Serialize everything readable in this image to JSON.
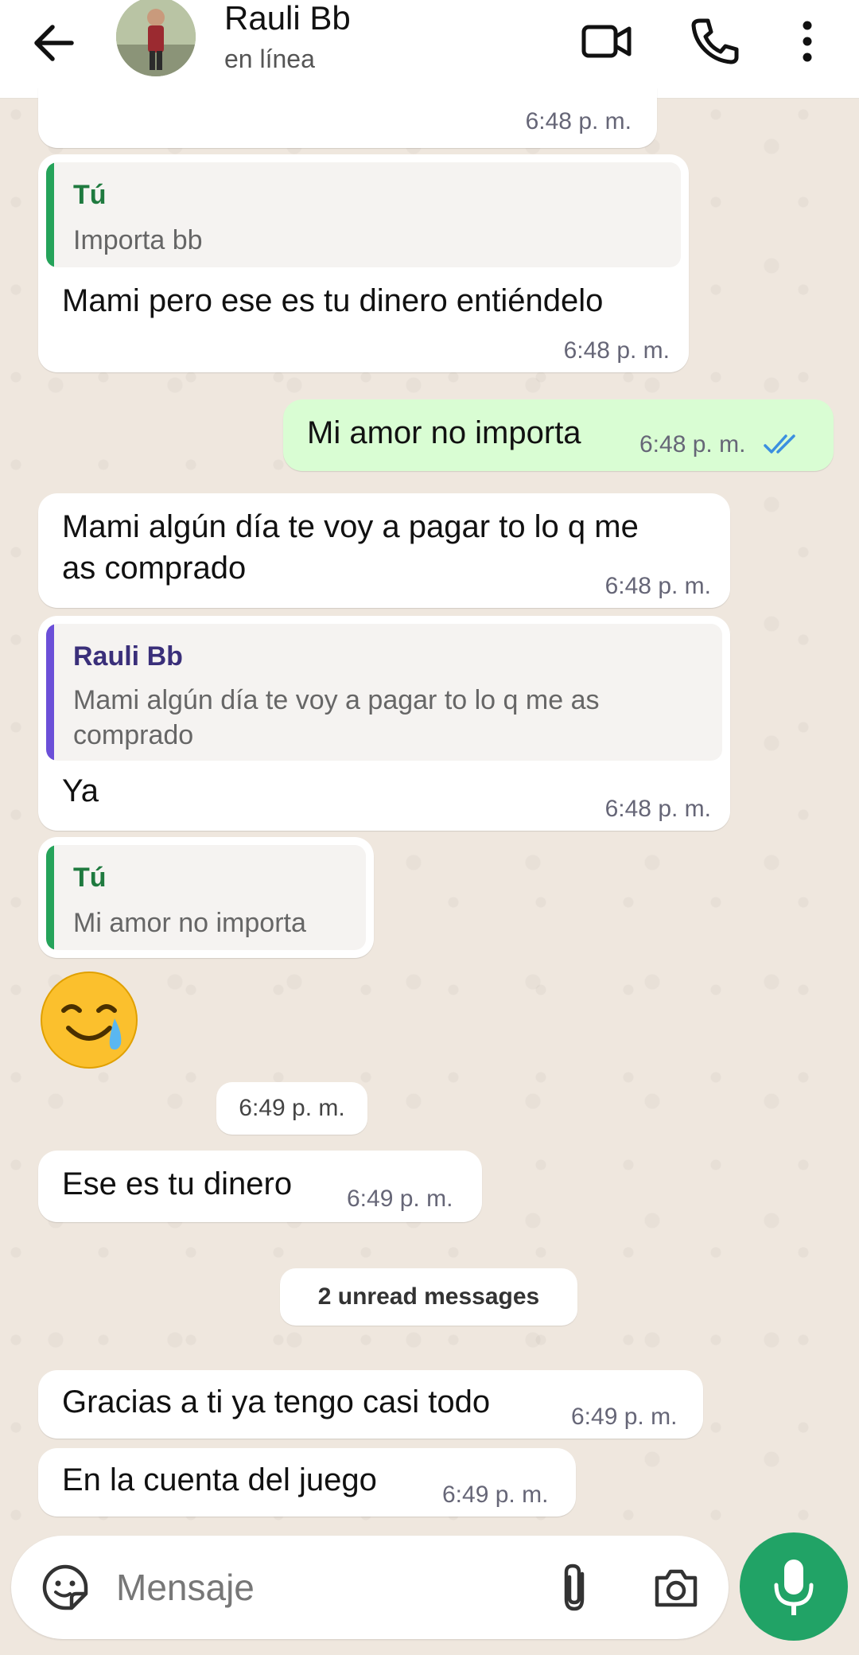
{
  "header": {
    "contact_name": "Rauli Bb",
    "status": "en línea",
    "icons": [
      "arrow-back-icon",
      "video-call-icon",
      "phone-icon",
      "more-vertical-icon"
    ]
  },
  "messages": [
    {
      "direction": "in",
      "text": "",
      "time": "6:48 p. m."
    },
    {
      "direction": "in",
      "quote": {
        "author": "Tú",
        "text": "Importa bb"
      },
      "text": "Mami pero ese es tu dinero entiéndelo",
      "time": "6:48 p. m."
    },
    {
      "direction": "out",
      "text": "Mi amor no importa",
      "time": "6:48 p. m.",
      "status": "read"
    },
    {
      "direction": "in",
      "text_line1": "Mami algún día te voy a pagar to lo q me",
      "text_line2": "as comprado",
      "time": "6:48 p. m."
    },
    {
      "direction": "in",
      "quote": {
        "author": "Rauli Bb",
        "text_line1": "Mami algún día te voy a pagar to lo q me as",
        "text_line2": "comprado"
      },
      "text": "Ya",
      "time": "6:48 p. m."
    },
    {
      "direction": "in",
      "quote": {
        "author": "Tú",
        "text": "Mi amor no importa"
      },
      "emoji": "🥲",
      "time": "6:49 p. m."
    },
    {
      "direction": "in",
      "text": "Ese es tu dinero",
      "time": "6:49 p. m."
    },
    {
      "direction": "in",
      "text": "Gracias a ti ya tengo casi todo",
      "time": "6:49 p. m."
    },
    {
      "direction": "in",
      "text": "En la cuenta del juego",
      "time": "6:49 p. m."
    }
  ],
  "unread_divider": "2 unread messages",
  "composer": {
    "placeholder": "Mensaje",
    "icons": [
      "sticker-icon",
      "attach-icon",
      "camera-icon",
      "mic-icon"
    ]
  },
  "colors": {
    "outgoing_bubble": "#d9fdd3",
    "incoming_bubble": "#ffffff",
    "wallpaper": "#efe7de",
    "accent_green": "#21a366",
    "quote_self_bar": "#25a35a",
    "quote_other_bar": "#6b4fd8",
    "read_ticks": "#3b8fe0"
  }
}
